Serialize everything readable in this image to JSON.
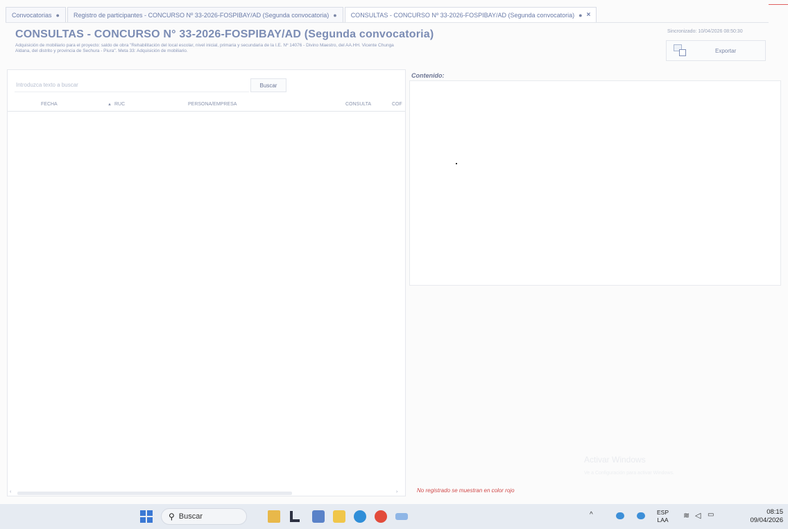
{
  "tabs": [
    {
      "label": "Convocatorias",
      "marker": "●",
      "closable": false
    },
    {
      "label": "Registro de participantes - CONCURSO Nº 33-2026-FOSPIBAY/AD (Segunda convocatoria)",
      "marker": "●",
      "closable": false
    },
    {
      "label": "CONSULTAS - CONCURSO Nº 33-2026-FOSPIBAY/AD (Segunda convocatoria)",
      "marker": "●",
      "closable": true,
      "close": "×"
    }
  ],
  "header": {
    "title": "CONSULTAS  - CONCURSO N° 33-2026-FOSPIBAY/AD (Segunda convocatoria)",
    "description": "Adquisición de mobiliario para el proyecto: saldo de obra \"Rehabilitación del local escolar, nivel inicial, primaria y secundaria de la I.E. Nº 14076 - Divino Maestro, del AA.HH. Vicente Chunga Aldana, del distrito y provincia de Sechura - Piura\". Meta 33: Adquisición de mobiliario.",
    "sync": "Sincronizado: 10/04/2026 08:50:30",
    "export_label": "Exportar"
  },
  "search": {
    "placeholder": "Introduzca texto a buscar",
    "button_label": "Buscar"
  },
  "grid": {
    "columns": [
      "FECHA",
      "RUC",
      "PERSONA/EMPRESA",
      "CONSULTA",
      "COF"
    ],
    "sort_indicator": "▲",
    "rows": []
  },
  "content": {
    "label": "Contenido:"
  },
  "watermark": {
    "title": "Activar Windows",
    "subtitle": "Ve a Configuración para activar Windows."
  },
  "note": "No registrado se muestran en color rojo",
  "taskbar": {
    "search_label": "Buscar",
    "lang_top": "ESP",
    "lang_bottom": "LAA",
    "time": "08:15",
    "date": "09/04/2026"
  },
  "colors": {
    "title": "#7b8cb4",
    "note_red": "#d04a4a",
    "taskbar_bg": "#e6ebf2"
  }
}
